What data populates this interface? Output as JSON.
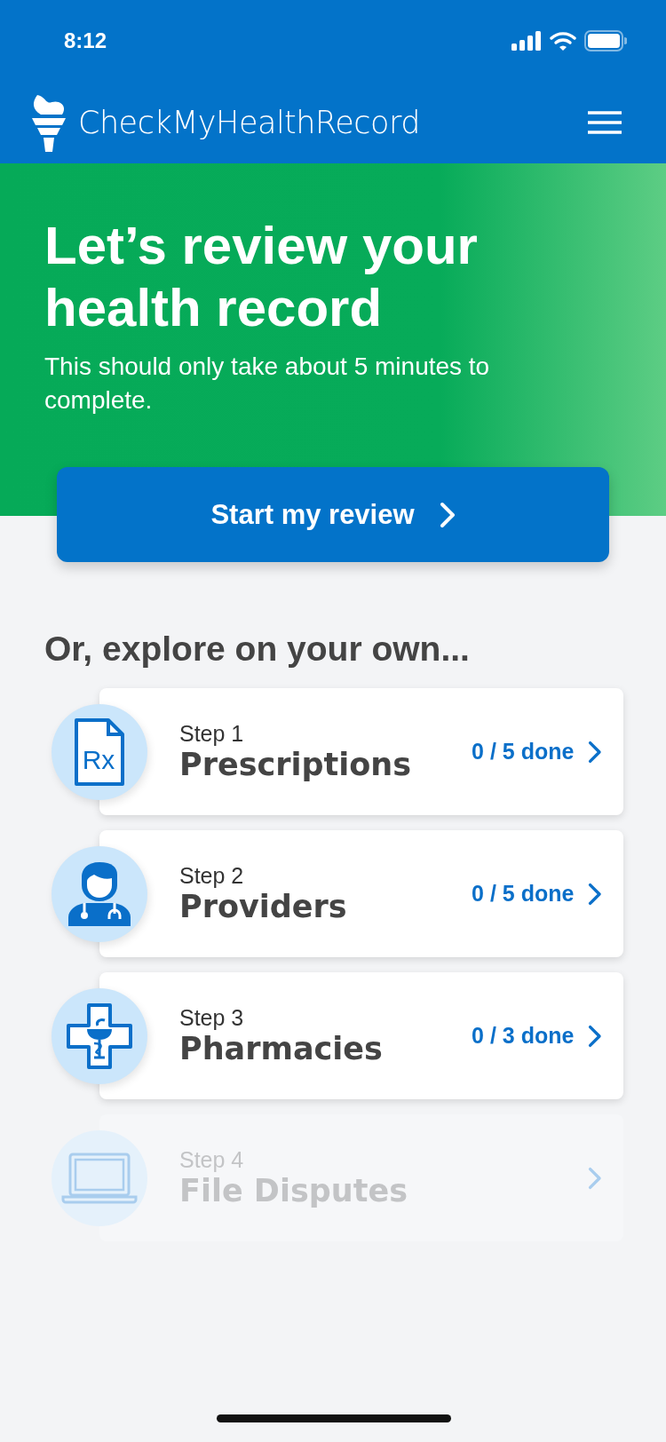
{
  "status_bar": {
    "time": "8:12"
  },
  "header": {
    "brand": "CheckMyHealthRecord"
  },
  "hero": {
    "title": "Let’s review your health record",
    "subtitle": "This should only take about 5 minutes to complete."
  },
  "start_button": {
    "label": "Start my review"
  },
  "section_title": "Or, explore on your own...",
  "steps": [
    {
      "kind": "prescription",
      "icon_label": "Rx",
      "step": "Step 1",
      "title": "Prescriptions",
      "progress": "0 / 5 done",
      "disabled": false
    },
    {
      "kind": "provider",
      "step": "Step 2",
      "title": "Providers",
      "progress": "0 / 5 done",
      "disabled": false
    },
    {
      "kind": "pharmacy",
      "step": "Step 3",
      "title": "Pharmacies",
      "progress": "0 / 3 done",
      "disabled": false
    },
    {
      "kind": "dispute",
      "step": "Step 4",
      "title": "File Disputes",
      "disabled": true
    }
  ]
}
